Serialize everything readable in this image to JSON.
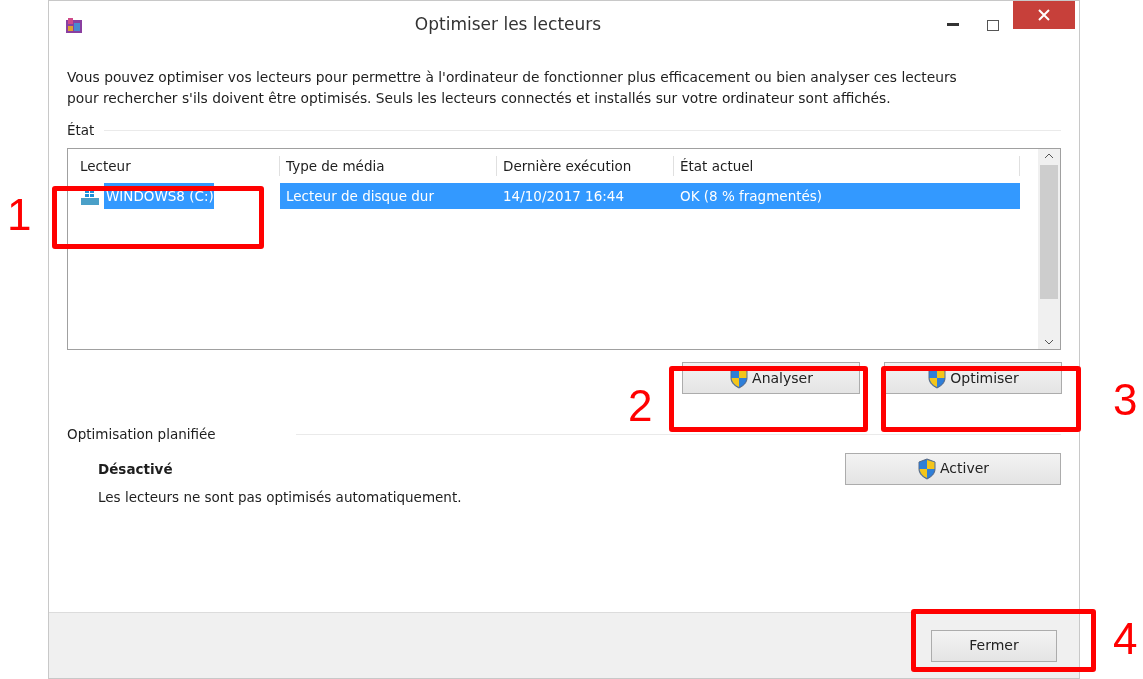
{
  "window": {
    "title": "Optimiser les lecteurs"
  },
  "description": "Vous pouvez optimiser vos lecteurs pour permettre à l'ordinateur de fonctionner plus efficacement ou bien analyser ces lecteurs pour rechercher s'ils doivent être optimisés. Seuls les lecteurs connectés et installés sur votre ordinateur sont affichés.",
  "status_group": {
    "label": "État",
    "table": {
      "columns": [
        "Lecteur",
        "Type de média",
        "Dernière exécution",
        "État actuel"
      ],
      "rows": [
        {
          "cells": [
            "WINDOWS8 (C:)",
            "Lecteur de disque dur",
            "14/10/2017 16:44",
            "OK (8 % fragmentés)"
          ],
          "selected": true
        }
      ]
    }
  },
  "actions": [
    {
      "label": "Analyser"
    },
    {
      "label": "Optimiser"
    }
  ],
  "schedule": {
    "label": "Optimisation planifiée",
    "state": "Désactivé",
    "note": "Les lecteurs ne sont pas optimisés automatiquement.",
    "button": "Activer"
  },
  "footer": {
    "button": "Fermer"
  },
  "callouts": [
    {
      "label": "1"
    },
    {
      "label": "2"
    },
    {
      "label": "3"
    },
    {
      "label": "4"
    }
  ]
}
